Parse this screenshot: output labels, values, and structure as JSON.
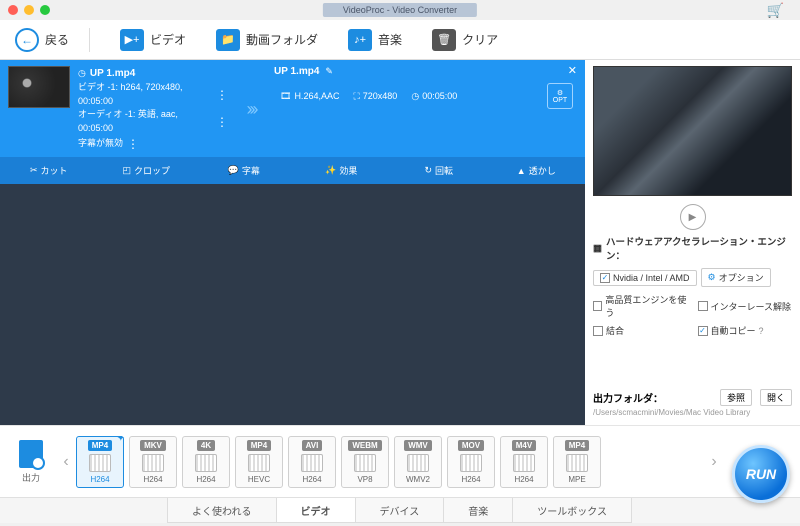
{
  "window": {
    "title": "VideoProc - Video Converter"
  },
  "toolbar": {
    "back": "戻る",
    "video": "ビデオ",
    "folder": "動画フォルダ",
    "music": "音楽",
    "clear": "クリア"
  },
  "card": {
    "src": {
      "filename": "UP 1.mp4",
      "video_line": "ビデオ -1: h264, 720x480, 00:05:00",
      "audio_line": "オーディオ -1: 英語, aac, 00:05:00",
      "sub_line": "字幕が無効"
    },
    "out": {
      "filename": "UP 1.mp4",
      "codec": "H.264,AAC",
      "res": "720x480",
      "dur": "00:05:00",
      "opt": "OPT",
      "codec_label": "codec"
    },
    "tools": {
      "cut": "カット",
      "crop": "クロップ",
      "subtitle": "字幕",
      "effect": "効果",
      "rotate": "回転",
      "watermark": "透かし"
    }
  },
  "settings": {
    "hw_title": "ハードウェアアクセラレーション・エンジン：",
    "hw_vendors": "Nvidia /  Intel / AMD",
    "option_btn": "オプション",
    "hq_engine": "高品質エンジンを使う",
    "deinterlace": "インターレース解除",
    "merge": "結合",
    "autocopy": "自動コピー",
    "out_folder_label": "出力フォルダ：",
    "browse": "参照",
    "open": "開く",
    "out_path": "/Users/scmacmini/Movies/Mac Video Library"
  },
  "output_label": "出力",
  "formats": [
    {
      "name": "MP4",
      "sub": "H264",
      "selected": true
    },
    {
      "name": "MKV",
      "sub": "H264",
      "selected": false
    },
    {
      "name": "4K",
      "sub": "H264",
      "selected": false
    },
    {
      "name": "MP4",
      "sub": "HEVC",
      "selected": false
    },
    {
      "name": "AVI",
      "sub": "H264",
      "selected": false
    },
    {
      "name": "WEBM",
      "sub": "VP8",
      "selected": false
    },
    {
      "name": "WMV",
      "sub": "WMV2",
      "selected": false
    },
    {
      "name": "MOV",
      "sub": "H264",
      "selected": false
    },
    {
      "name": "M4V",
      "sub": "H264",
      "selected": false
    },
    {
      "name": "MP4",
      "sub": "MPE",
      "selected": false
    }
  ],
  "run": "RUN",
  "tabs": {
    "frequent": "よく使われる",
    "video": "ビデオ",
    "device": "デバイス",
    "music": "音楽",
    "toolbox": "ツールボックス"
  }
}
